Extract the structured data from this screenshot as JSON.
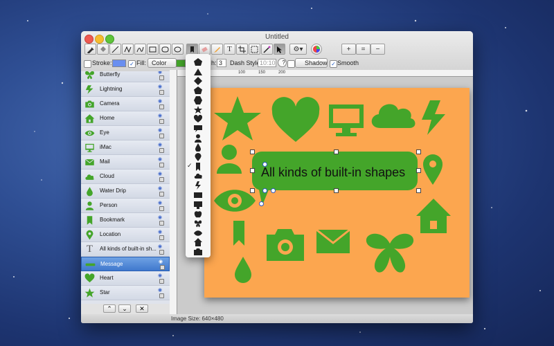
{
  "window": {
    "title": "Untitled"
  },
  "options": {
    "stroke_label": "Stroke:",
    "fill_label": "Fill:",
    "fill_mode": "Color",
    "width_value": "3",
    "dash_style_label": "Dash Style:",
    "dash_value": "10:10",
    "help": "?",
    "shadow_label": "Shadow",
    "smooth_label": "Smooth",
    "width_partial": "h:"
  },
  "ruler": {
    "ticks": [
      "100",
      "150",
      "200"
    ]
  },
  "layers": [
    {
      "label": "Butterfly",
      "icon": "butterfly-icon"
    },
    {
      "label": "Lightning",
      "icon": "lightning-icon"
    },
    {
      "label": "Camera",
      "icon": "camera-icon"
    },
    {
      "label": "Home",
      "icon": "home-icon"
    },
    {
      "label": "Eye",
      "icon": "eye-icon"
    },
    {
      "label": "iMac",
      "icon": "imac-icon"
    },
    {
      "label": "Mail",
      "icon": "mail-icon"
    },
    {
      "label": "Cloud",
      "icon": "cloud-icon"
    },
    {
      "label": "Water Drip",
      "icon": "water-drip-icon"
    },
    {
      "label": "Person",
      "icon": "person-icon"
    },
    {
      "label": "Bookmark",
      "icon": "bookmark-icon"
    },
    {
      "label": "Location",
      "icon": "location-icon"
    },
    {
      "label": "All kinds of built-in sh...",
      "icon": "text-icon"
    },
    {
      "label": "Message",
      "icon": "message-icon"
    },
    {
      "label": "Heart",
      "icon": "heart-icon"
    },
    {
      "label": "Star",
      "icon": "star-icon"
    }
  ],
  "selected_layer": "Message",
  "canvas": {
    "bubble_text": "All kinds of built-in shapes"
  },
  "status": {
    "image_size": "Image Size: 640×480"
  },
  "shape_menu": {
    "items": [
      "pentagon-icon",
      "triangle-icon",
      "diamond-icon",
      "pentagon-icon",
      "hexagon-icon",
      "star-icon",
      "heart-icon",
      "message-icon",
      "person-icon",
      "water-drip-icon",
      "location-icon",
      "bookmark-icon",
      "cloud-icon",
      "lightning-icon",
      "mail-icon",
      "imac-icon",
      "apple-icon",
      "butterfly-icon",
      "eye-icon",
      "home-icon",
      "camera-icon"
    ],
    "checked": "bookmark-icon"
  },
  "colors": {
    "shape_green": "#44a52a",
    "canvas_orange": "#fca64f",
    "accent_blue": "#3f78cd"
  }
}
